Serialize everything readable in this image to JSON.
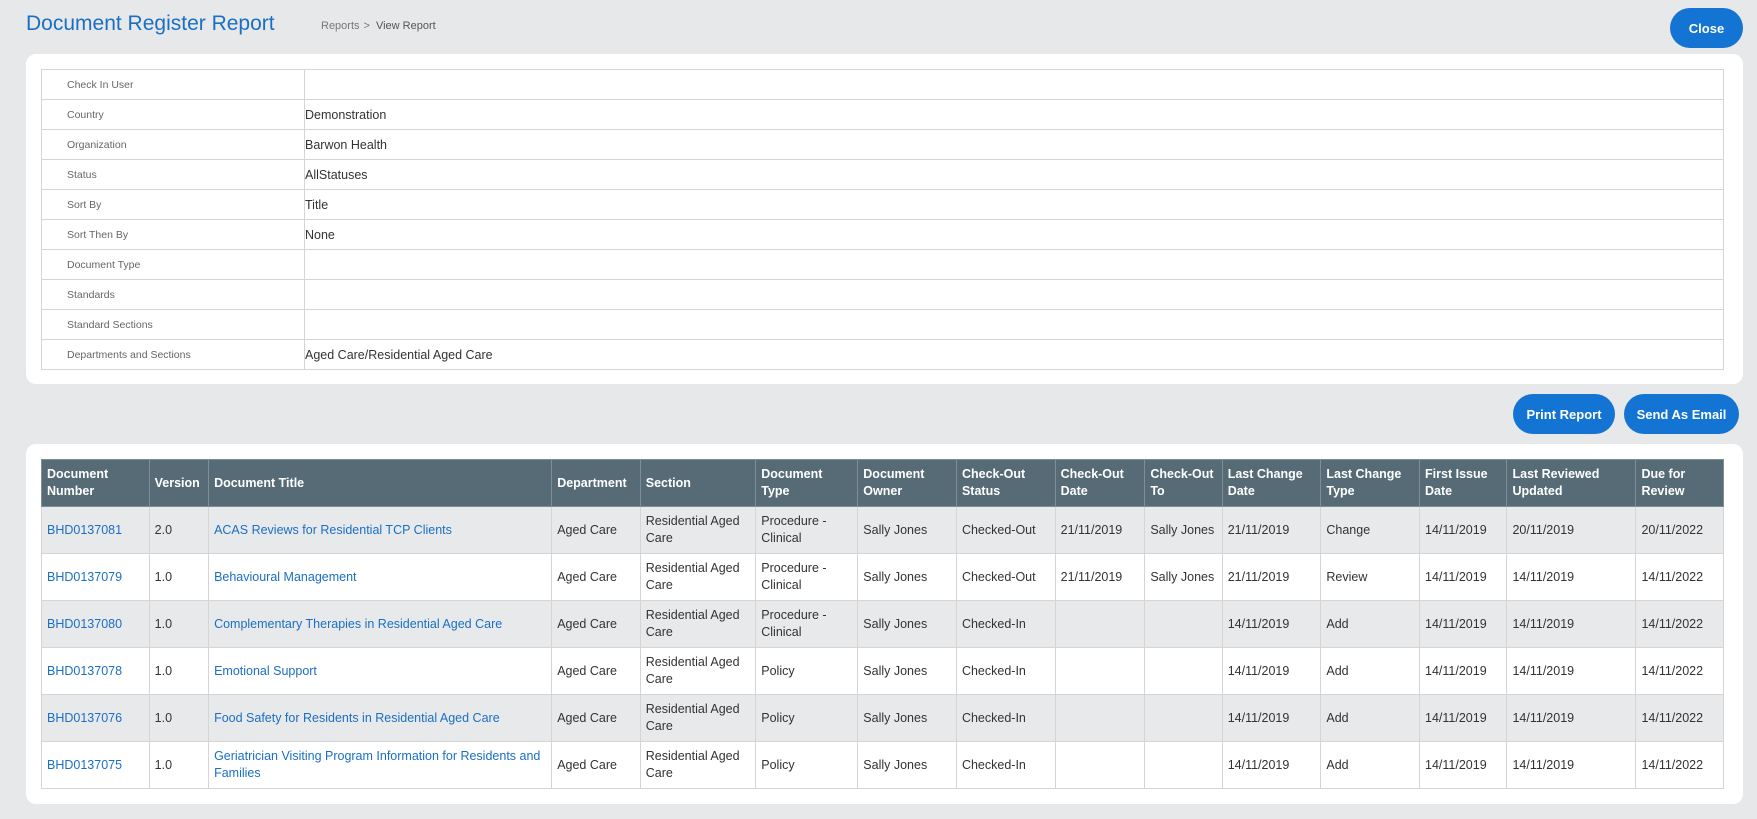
{
  "header": {
    "title": "Document Register Report",
    "breadcrumb_parent": "Reports",
    "breadcrumb_sep": ">",
    "breadcrumb_current": "View Report",
    "close_label": "Close"
  },
  "criteria": [
    {
      "label": "Check In User",
      "value": ""
    },
    {
      "label": "Country",
      "value": "Demonstration"
    },
    {
      "label": "Organization",
      "value": "Barwon Health"
    },
    {
      "label": "Status",
      "value": "AllStatuses"
    },
    {
      "label": "Sort By",
      "value": "Title"
    },
    {
      "label": "Sort Then By",
      "value": "None"
    },
    {
      "label": "Document Type",
      "value": ""
    },
    {
      "label": "Standards",
      "value": ""
    },
    {
      "label": "Standard Sections",
      "value": ""
    },
    {
      "label": "Departments and Sections",
      "value": "Aged Care/Residential Aged Care"
    }
  ],
  "actions": {
    "print_label": "Print Report",
    "email_label": "Send As Email"
  },
  "table": {
    "columns": [
      "Document Number",
      "Version",
      "Document Title",
      "Department",
      "Section",
      "Document Type",
      "Document Owner",
      "Check-Out Status",
      "Check-Out Date",
      "Check-Out To",
      "Last Change Date",
      "Last Change Type",
      "First Issue Date",
      "Last Reviewed Updated",
      "Due for Review"
    ],
    "rows": [
      [
        "BHD0137081",
        "2.0",
        "ACAS Reviews for Residential TCP Clients",
        "Aged Care",
        "Residential Aged Care",
        "Procedure - Clinical",
        "Sally Jones",
        "Checked-Out",
        "21/11/2019",
        "Sally Jones",
        "21/11/2019",
        "Change",
        "14/11/2019",
        "20/11/2019",
        "20/11/2022"
      ],
      [
        "BHD0137079",
        "1.0",
        "Behavioural Management",
        "Aged Care",
        "Residential Aged Care",
        "Procedure - Clinical",
        "Sally Jones",
        "Checked-Out",
        "21/11/2019",
        "Sally Jones",
        "21/11/2019",
        "Review",
        "14/11/2019",
        "14/11/2019",
        "14/11/2022"
      ],
      [
        "BHD0137080",
        "1.0",
        "Complementary Therapies in Residential Aged Care",
        "Aged Care",
        "Residential Aged Care",
        "Procedure - Clinical",
        "Sally Jones",
        "Checked-In",
        "",
        "",
        "14/11/2019",
        "Add",
        "14/11/2019",
        "14/11/2019",
        "14/11/2022"
      ],
      [
        "BHD0137078",
        "1.0",
        "Emotional Support",
        "Aged Care",
        "Residential Aged Care",
        "Policy",
        "Sally Jones",
        "Checked-In",
        "",
        "",
        "14/11/2019",
        "Add",
        "14/11/2019",
        "14/11/2019",
        "14/11/2022"
      ],
      [
        "BHD0137076",
        "1.0",
        "Food Safety for Residents in Residential Aged Care",
        "Aged Care",
        "Residential Aged Care",
        "Policy",
        "Sally Jones",
        "Checked-In",
        "",
        "",
        "14/11/2019",
        "Add",
        "14/11/2019",
        "14/11/2019",
        "14/11/2022"
      ],
      [
        "BHD0137075",
        "1.0",
        "Geriatrician Visiting Program Information for Residents and Families",
        "Aged Care",
        "Residential Aged Care",
        "Policy",
        "Sally Jones",
        "Checked-In",
        "",
        "",
        "14/11/2019",
        "Add",
        "14/11/2019",
        "14/11/2019",
        "14/11/2022"
      ]
    ]
  }
}
